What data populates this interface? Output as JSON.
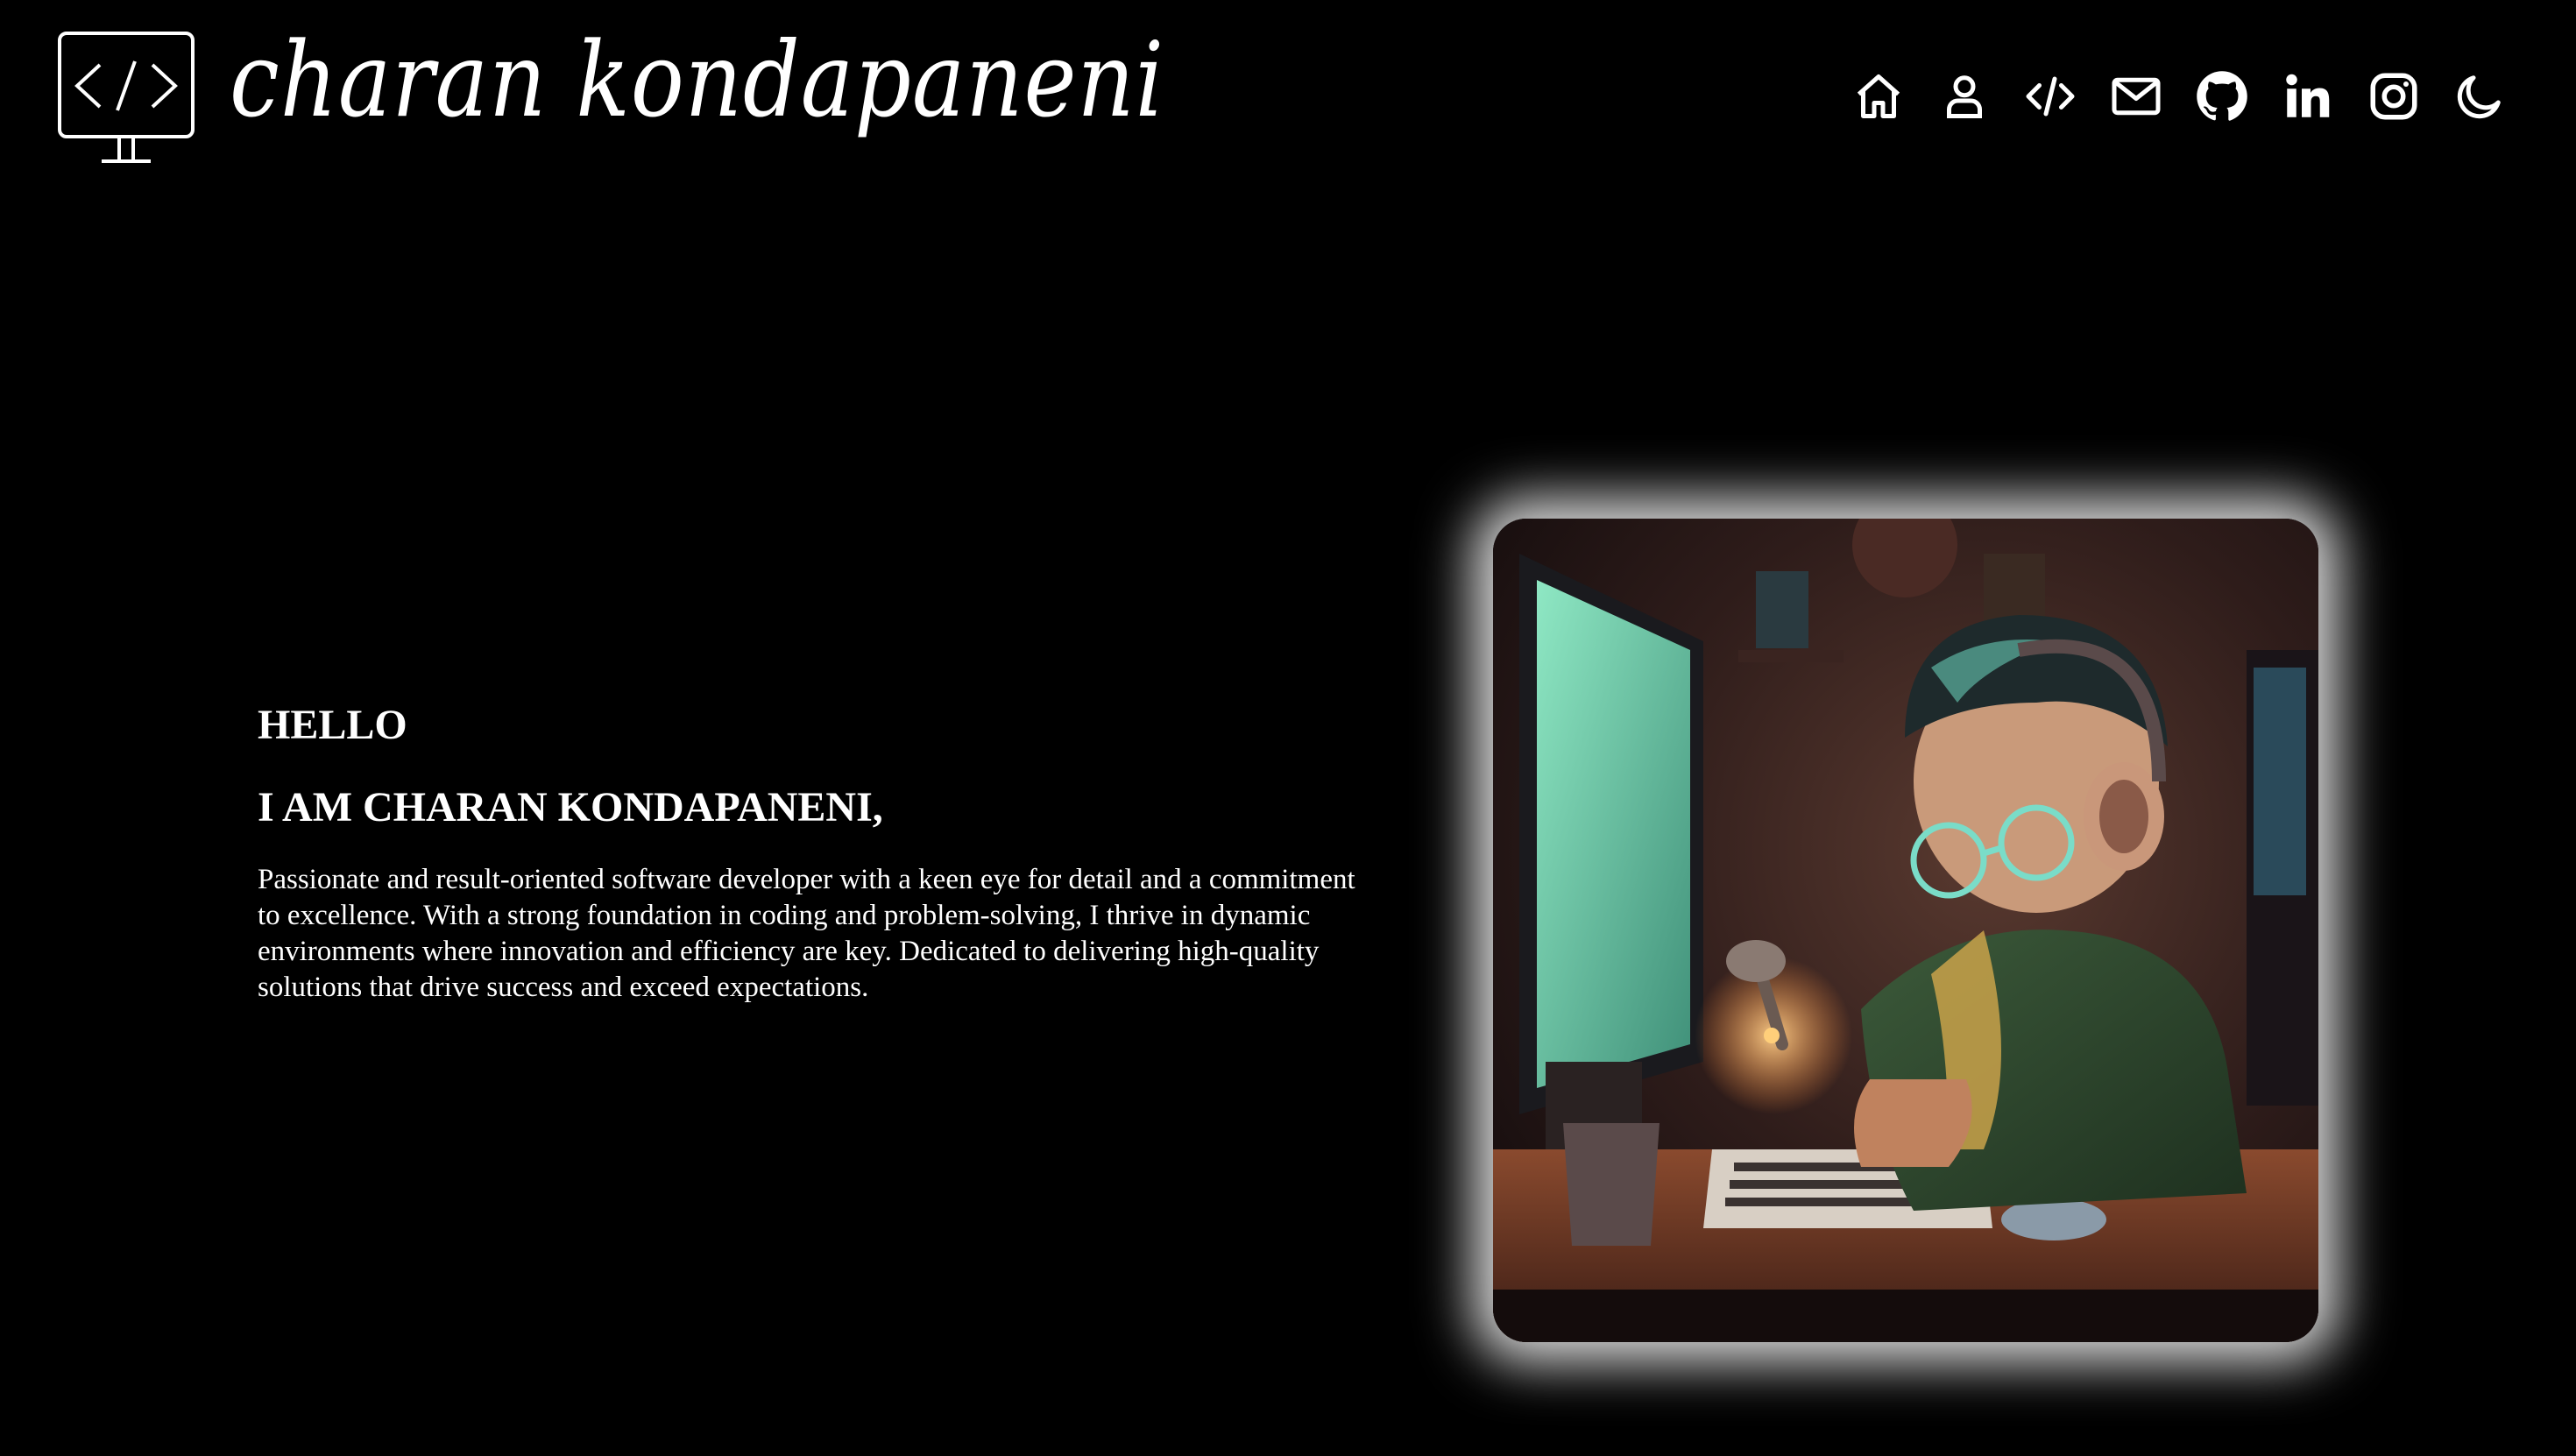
{
  "header": {
    "brand_name": "charan kondapaneni",
    "nav": [
      {
        "name": "home",
        "icon": "home-icon"
      },
      {
        "name": "about",
        "icon": "user-icon"
      },
      {
        "name": "projects",
        "icon": "code-icon"
      },
      {
        "name": "contact",
        "icon": "mail-icon"
      },
      {
        "name": "github",
        "icon": "github-icon"
      },
      {
        "name": "linkedin",
        "icon": "linkedin-icon"
      },
      {
        "name": "instagram",
        "icon": "instagram-icon"
      },
      {
        "name": "theme",
        "icon": "moon-icon"
      }
    ]
  },
  "hero": {
    "greeting": "HELLO",
    "intro": "I AM CHARAN KONDAPANENI,",
    "bio": "Passionate and result-oriented software developer with a keen eye for detail and a commitment to excellence. With a strong foundation in coding and problem-solving, I thrive in dynamic environments where innovation and efficiency are key. Dedicated to delivering high-quality solutions that drive success and exceed expectations."
  },
  "colors": {
    "background": "#000000",
    "text": "#ffffff",
    "image_glow": "#ffffff"
  }
}
